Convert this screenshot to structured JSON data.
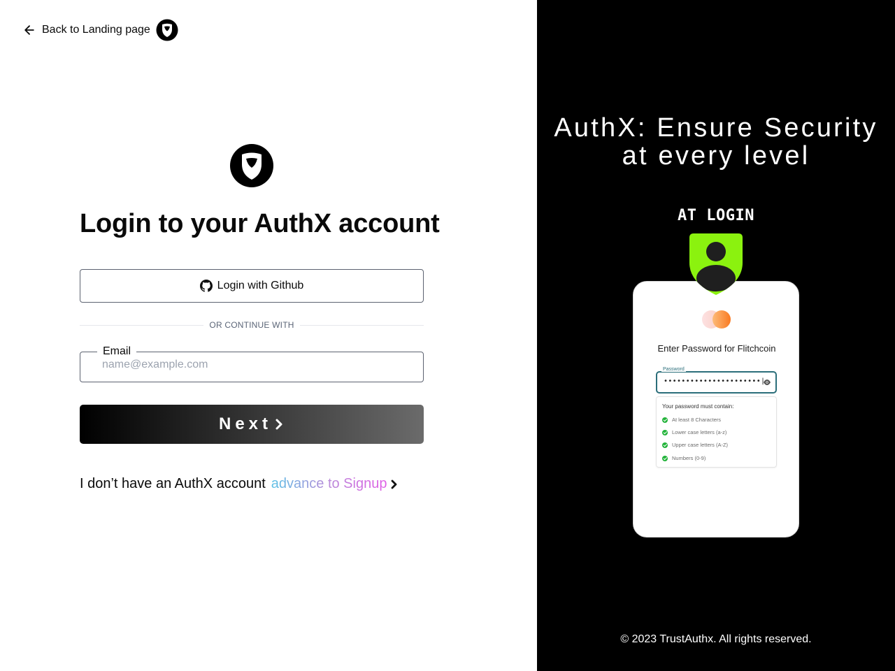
{
  "nav": {
    "back_label": "Back to Landing page"
  },
  "login": {
    "title": "Login to your AuthX account",
    "github_label": "Login with Github",
    "divider_text": "OR CONTINUE WITH",
    "email": {
      "label": "Email",
      "value": "",
      "placeholder": "name@example.com"
    },
    "next_label": "Next",
    "no_account_text": "I don’t have an AuthX account",
    "signup_link": "advance to Signup"
  },
  "promo": {
    "headline": "AuthX: Ensure Security at every level",
    "stage_label": "AT LOGIN",
    "phone": {
      "prompt": "Enter Password for Flitchcoin",
      "password_label": "Password",
      "password_dots": "••••••••••••••••••••••|",
      "rules_title": "Your password must contain:",
      "rules": [
        "At least 8 Characters",
        "Lower case letters (a-z)",
        "Upper case letters (A-Z)",
        "Numbers (0-9)"
      ]
    },
    "copyright": "© 2023 TrustAuthx. All rights reserved."
  },
  "colors": {
    "badge_green": "#8bf20f",
    "check_green": "#22b33a",
    "signup_gradient": [
      "#5bc1e6",
      "#b98ad9",
      "#e05ee6"
    ],
    "toggle_orange": "#f97316",
    "field_focus": "#2b6e7a"
  },
  "icons": {
    "back": "arrow-left-icon",
    "brand": "shield-logo-icon",
    "github": "github-icon",
    "next_chevron": "chevron-right-icon",
    "signup_chevron": "chevron-right-icon",
    "badge": "user-shield-icon",
    "eye": "eye-icon",
    "check": "check-circle-icon"
  }
}
